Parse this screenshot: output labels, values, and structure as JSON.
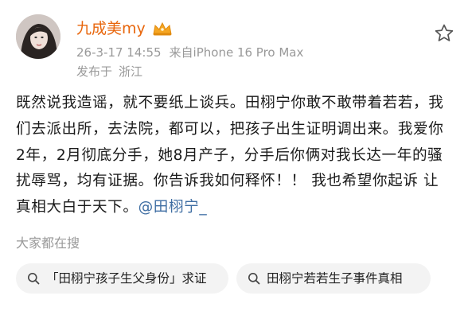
{
  "post": {
    "username": "九成美my",
    "timestamp": "26-3-17 14:55",
    "source": "来自iPhone 16 Pro Max",
    "location_prefix": "发布于",
    "location": "浙江",
    "text": "既然说我造谣，就不要纸上谈兵。田栩宁你敢不敢带着若若，我们去派出所，去法院，都可以，把孩子出生证明调出来。我爱你2年，2月彻底分手，她8月产子，分手后你俩对我长达一年的骚扰辱骂，均有证据。你告诉我如何释怀！！ 我也希望你起诉 让真相大白于天下。",
    "mention": "@田栩宁_"
  },
  "search": {
    "heading": "大家都在搜",
    "chips": [
      {
        "label": "「田栩宁孩子生父身份」求证"
      },
      {
        "label": "田栩宁若若生子事件真相"
      }
    ]
  },
  "icons": {
    "vip": "crown-badge-icon",
    "favorite": "star-outline-icon",
    "search": "search-icon"
  },
  "colors": {
    "username": "#e8660c",
    "mention": "#3f6ea3",
    "meta": "#999999"
  }
}
